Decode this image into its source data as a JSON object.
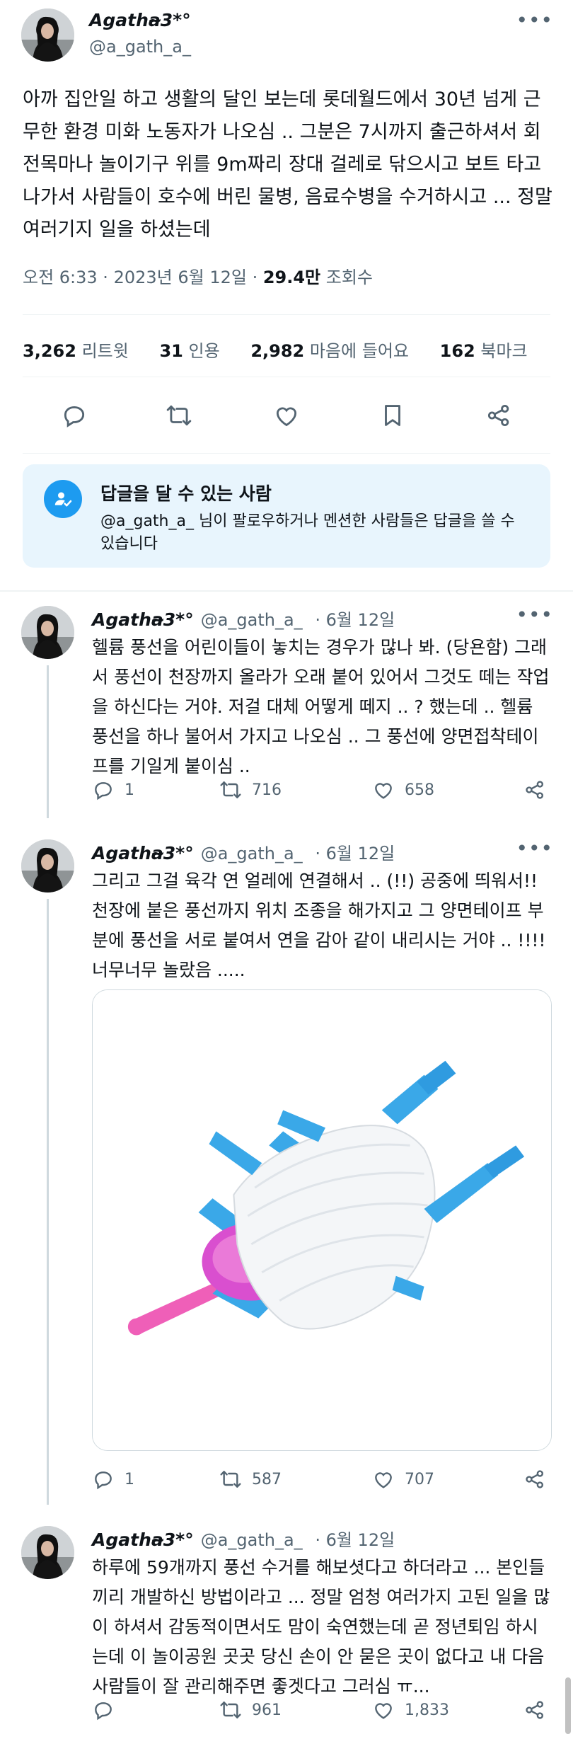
{
  "colors": {
    "accent": "#1d9bf0",
    "text": "#0f1419",
    "muted": "#536471",
    "notice_bg": "#e8f5fd"
  },
  "main_tweet": {
    "display_name": "Agatha̴3*°",
    "handle": "@a_gath_a_",
    "more_icon": "more-icon",
    "text": "아까 집안일 하고 생활의 달인 보는데 롯데월드에서 30년 넘게 근무한 환경 미화 노동자가 나오심 .. 그분은 7시까지 출근하셔서 회전목마나 놀이기구 위를 9m짜리 장대 걸레로 닦으시고 보트 타고 나가서 사람들이 호수에 버린 물병, 음료수병을 수거하시고 ... 정말 여러기지 일을 하셨는데",
    "time": "오전 6:33 · 2023년 6월 12일 · ",
    "views": "29.4만",
    "views_label": " 조회수",
    "stats": {
      "retweets": "3,262",
      "retweets_label": "리트윗",
      "quotes": "31",
      "quotes_label": "인용",
      "likes": "2,982",
      "likes_label": "마음에 들어요",
      "bookmarks": "162",
      "bookmarks_label": "북마크"
    },
    "actions": [
      "reply-icon",
      "retweet-icon",
      "like-icon",
      "bookmark-icon",
      "share-icon"
    ]
  },
  "notice": {
    "title": "답글을 달 수 있는 사람",
    "handle": "@a_gath_a_",
    "body": " 님이 팔로우하거나 멘션한 사람들은 답글을 쓸 수 있습니다"
  },
  "replies": [
    {
      "display_name": "Agatha̴3*°",
      "handle": "@a_gath_a_",
      "date": " · 6월 12일",
      "text": "헬륨 풍선을 어린이들이 놓치는 경우가 많나 봐. (당욘함) 그래서 풍선이 천장까지 올라가 오래 붙어 있어서 그것도 떼는 작업을 하신다는 거야. 저걸 대체 어떻게 떼지 .. ? 했는데 .. 헬륨 풍선을 하나 불어서 가지고 나오심 .. 그 풍선에 양면접착테이프를 기일게 붙이심 ..",
      "replies": "1",
      "retweets": "716",
      "likes": "658"
    },
    {
      "display_name": "Agatha̴3*°",
      "handle": "@a_gath_a_",
      "date": " · 6월 12일",
      "text": "그리고 그걸 육각 연 얼레에 연결해서 .. (!!) 공중에 띄워서!! 천장에 붙은 풍선까지 위치 조종을 해가지고 그 양면테이프 부분에 풍선을 서로 붙여서 연을 감아 같이 내리시는 거야 .. !!!! 너무너무 놀랐음 .....",
      "replies": "1",
      "retweets": "587",
      "likes": "707"
    },
    {
      "display_name": "Agatha̴3*°",
      "handle": "@a_gath_a_",
      "date": " · 6월 12일",
      "text": "하루에 59개까지 풍선 수거를 해보셧다고 하더라고 ... 본인들끼리 개발하신 방법이라고 ... 정말 엄청 여러가지 고된 일을 많이 하셔서 감동적이면서도 맘이 숙연했는데 곧 정년퇴임 하시는데 이 놀이공원 곳곳 당신 손이 안 묻은 곳이 없다고 내 다음 사람들이 잘 관리해주면 좋겟다고 그러심 ㅠ...",
      "replies": "",
      "retweets": "961",
      "likes": "1,833"
    }
  ]
}
